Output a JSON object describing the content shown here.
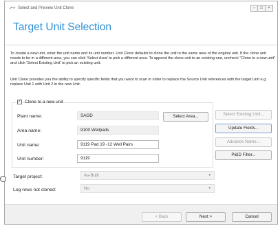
{
  "window": {
    "title": "Select and Preview Unit Clone",
    "controls": {
      "minimize": "–",
      "maximize": "□",
      "close": "×"
    }
  },
  "page": {
    "heading": "Target Unit Selection"
  },
  "instructions": {
    "p1": "To create a new unit, enter the unit name and its unit number.  Unit Clone defaults to clone the unit to the same area of the original unit.  If the clone unit needs to be in a different area, you can click 'Select Area' to pick a different area. To append the clone unit to an existing one,  uncheck \"Clone to a new unit\" and click 'Select Existing Unit' to pick an existing unit.",
    "p2": "Unit Clone provides you the ability to specify specific fields that you want to scan in order to replace the Source Unit references with the target Unit e.g. replace Unit 1 with Unit 2 in the new Unit."
  },
  "clone_new": {
    "label": "Clone to a new unit",
    "checked": true,
    "mark": "✓"
  },
  "form": {
    "plant_label": "Plant name:",
    "plant_value": "SAGD",
    "area_label": "Area name:",
    "area_value": "9100 Wellpads",
    "unit_name_label": "Unit name:",
    "unit_name_value": "9119 Pad 19 -12 Well Pairs",
    "unit_number_label": "Unit number:",
    "unit_number_value": "9119",
    "target_project_label": "Target project:",
    "target_project_value": "As-Built",
    "log_rows_label": "Log rows not cloned:",
    "log_rows_value": "No"
  },
  "buttons": {
    "select_area": "Select Area...",
    "select_existing_unit": "Select Existing Unit...",
    "update_fields": "Update Fields...",
    "advance_name": "Advance Name...",
    "pid_filter": "P&ID Filter...",
    "back": "<  Back",
    "next": "Next  >",
    "cancel": "Cancel"
  },
  "icons": {
    "dropdown": "▾"
  }
}
